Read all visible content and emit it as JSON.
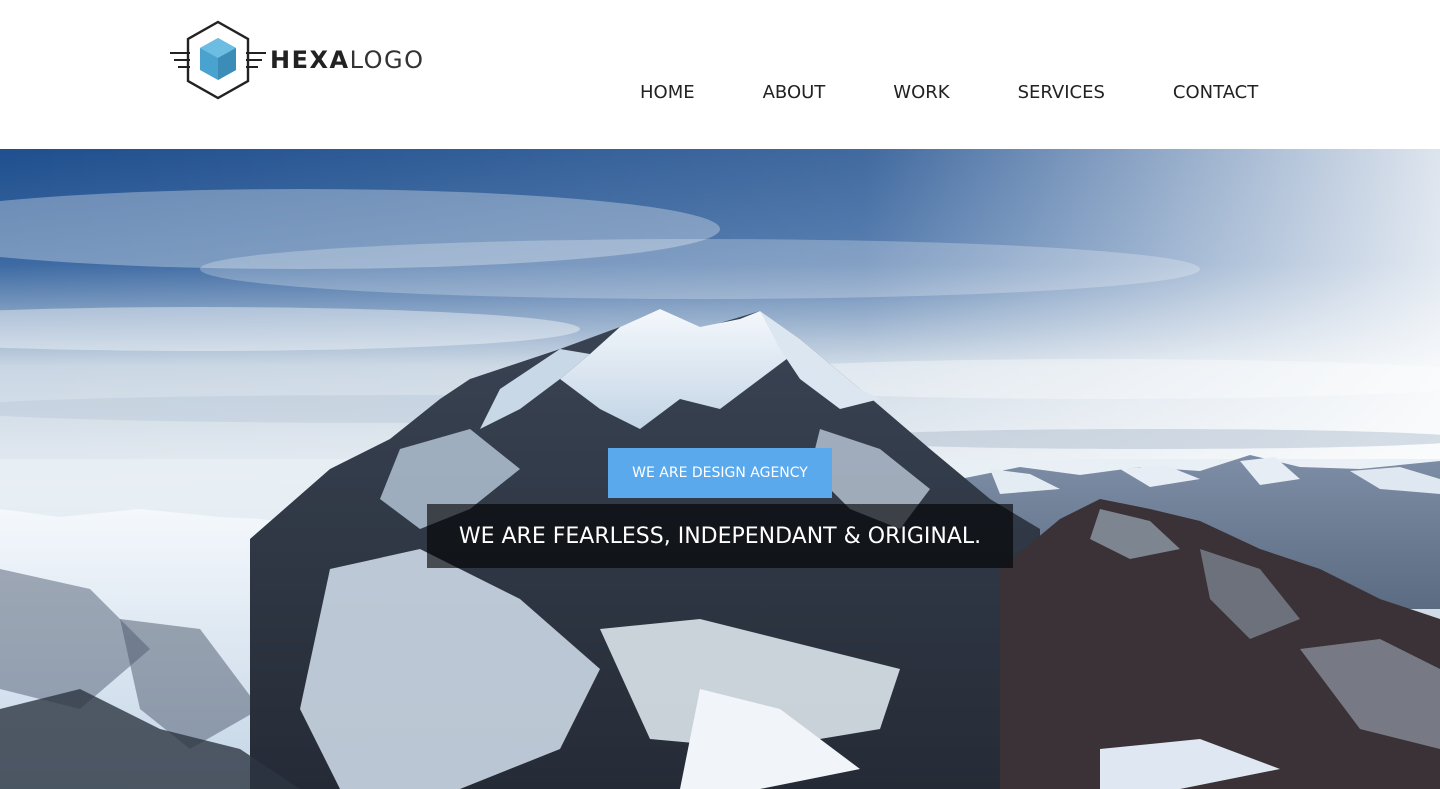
{
  "brand": {
    "logo_bold": "HEXA",
    "logo_light": "LOGO",
    "accent_color": "#4aa3cf"
  },
  "nav": {
    "items": [
      {
        "label": "HOME"
      },
      {
        "label": "ABOUT"
      },
      {
        "label": "WORK"
      },
      {
        "label": "SERVICES"
      },
      {
        "label": "CONTACT"
      }
    ]
  },
  "hero": {
    "badge": "WE ARE DESIGN AGENCY",
    "badge_color": "#5aa9ec",
    "headline": "WE ARE FEARLESS, INDEPENDANT & ORIGINAL.",
    "background_image": "snowy-mountain-peak-photo"
  }
}
